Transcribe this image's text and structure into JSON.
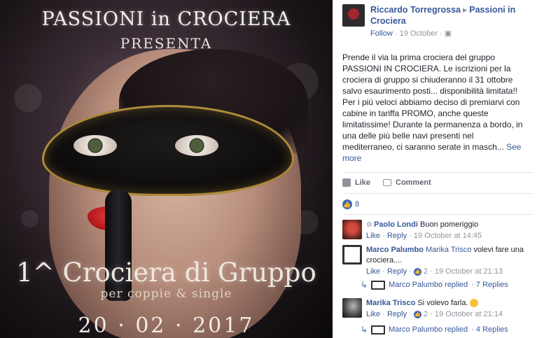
{
  "poster": {
    "title": "PASSIONI in CROCIERA",
    "presents": "PRESENTA",
    "cruise": "1^ Crociera di Gruppo",
    "audience": "per coppie & single",
    "date": "20 · 02 · 2017"
  },
  "post": {
    "author": "Riccardo Torregrossa",
    "arrow": "▸",
    "target": "Passioni in Crociera",
    "follow": "Follow",
    "date": "· 19 October ·",
    "body": "Prende il via la prima crociera del gruppo PASSIONI IN CROCIERA. Le iscrizioni per la crociera di gruppo si chiuderanno il 31 ottobre salvo esaurimento posti... disponibilità limitata!! Per i più veloci abbiamo deciso di premiarvi con cabine in tariffa PROMO, anche queste limitatissime! Durante la permanenza a bordo, in una delle più belle navi presenti nel mediterraneo, ci saranno serate in masch...",
    "see_more": "See more"
  },
  "actions": {
    "like": "Like",
    "comment": "Comment"
  },
  "reactions": {
    "count": "8"
  },
  "comments": [
    {
      "author": "Paolo Londi",
      "text": "Buon pomeriggio",
      "like": "Like",
      "reply": "Reply",
      "time": "· 19 October at 14:45"
    },
    {
      "author": "Marco Palumbo",
      "mention": "Marika Trisco",
      "text": "volevi fare una crociera....",
      "like": "Like",
      "reply": "Reply",
      "likes": "2",
      "time": "· 19 October at 21:13",
      "replies": {
        "author": "Marco Palumbo replied",
        "count": "· 7 Replies"
      }
    },
    {
      "author": "Marika Trisco",
      "text": "Si volevo farla.",
      "like": "Like",
      "reply": "Reply",
      "likes": "2",
      "time": "· 19 October at 21:14",
      "replies": {
        "author": "Marco Palumbo replied",
        "count": "· 4 Replies"
      }
    }
  ]
}
